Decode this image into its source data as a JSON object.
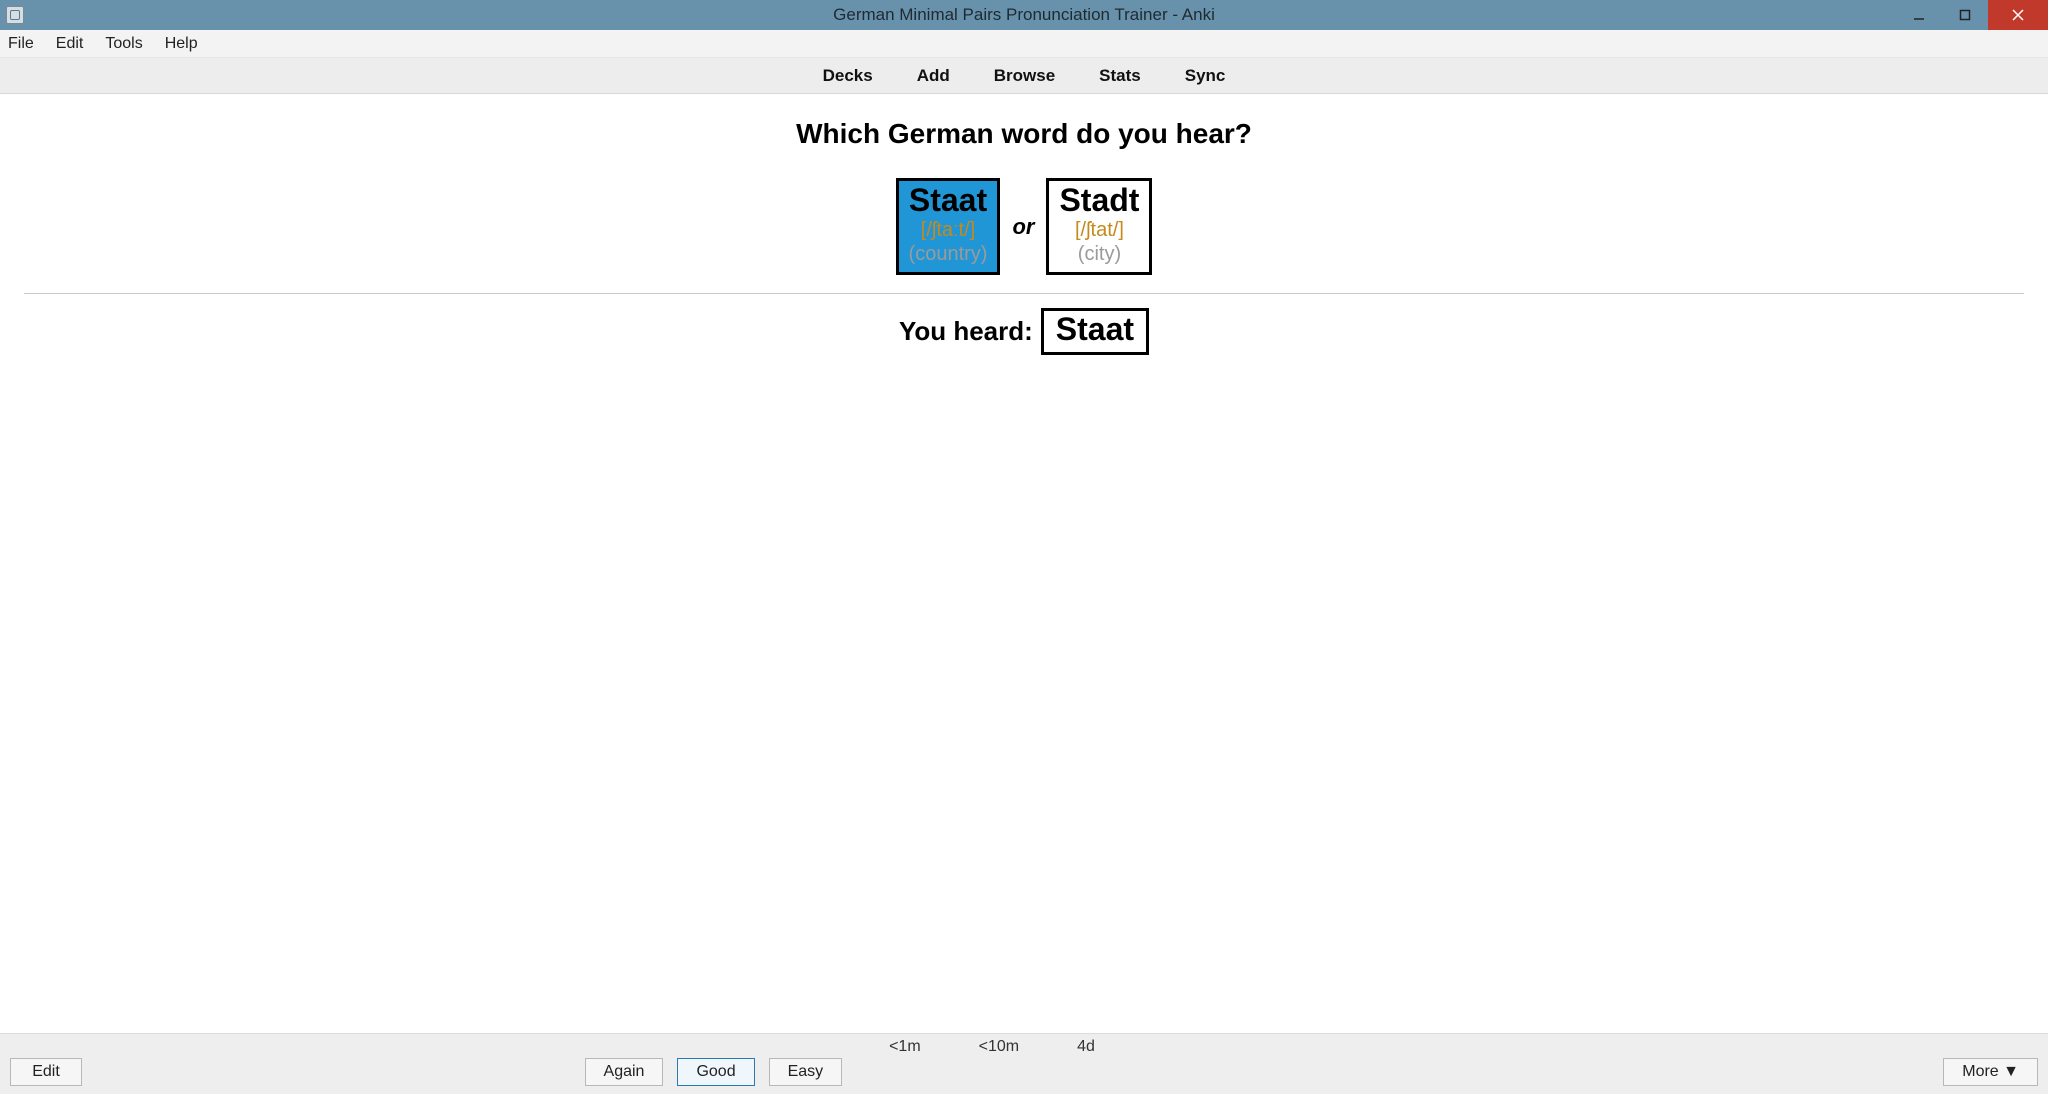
{
  "window": {
    "title": "German Minimal Pairs Pronunciation Trainer - Anki"
  },
  "menubar": {
    "file": "File",
    "edit": "Edit",
    "tools": "Tools",
    "help": "Help"
  },
  "toolbar": {
    "decks": "Decks",
    "add": "Add",
    "browse": "Browse",
    "stats": "Stats",
    "sync": "Sync"
  },
  "card": {
    "question": "Which German word do you hear?",
    "or_label": "or",
    "option1": {
      "word": "Staat",
      "ipa": "[/ʃtaːt/]",
      "translation": "(country)"
    },
    "option2": {
      "word": "Stadt",
      "ipa": "[/ʃtat/]",
      "translation": "(city)"
    },
    "answer_label": "You heard:",
    "answer_word": "Staat"
  },
  "bottom": {
    "intervals": {
      "again": "<1m",
      "good": "<10m",
      "easy": "4d"
    },
    "edit": "Edit",
    "again": "Again",
    "good": "Good",
    "easy": "Easy",
    "more": "More ▼"
  }
}
